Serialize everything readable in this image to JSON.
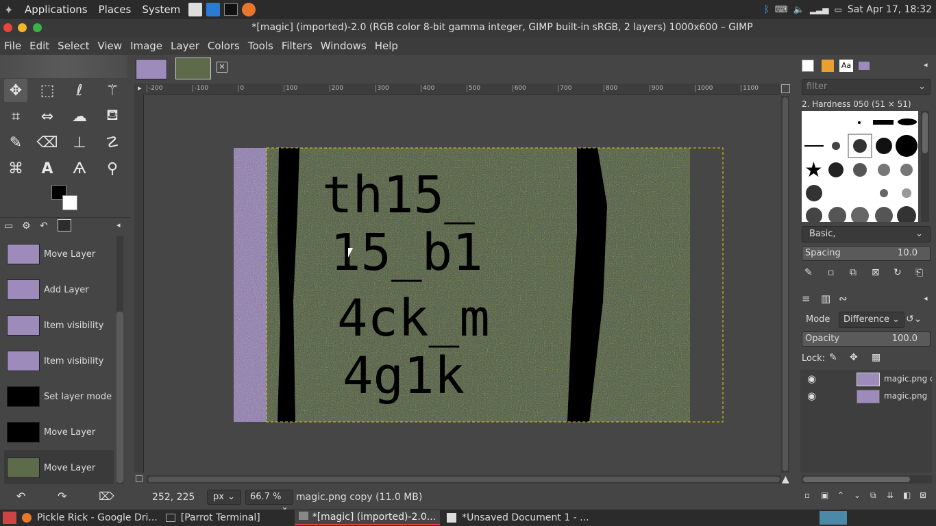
{
  "topbar": {
    "menus": [
      "Applications",
      "Places",
      "System"
    ],
    "clock": "Sat Apr 17, 18:32"
  },
  "window": {
    "title": "*[magic] (imported)-2.0 (RGB color 8-bit gamma integer, GIMP built-in sRGB, 2 layers) 1000x600 – GIMP"
  },
  "menubar": [
    "File",
    "Edit",
    "Select",
    "View",
    "Image",
    "Layer",
    "Colors",
    "Tools",
    "Filters",
    "Windows",
    "Help"
  ],
  "history": [
    {
      "label": "Move Layer",
      "thumb": "purple"
    },
    {
      "label": "Add Layer",
      "thumb": "purple"
    },
    {
      "label": "Item visibility",
      "thumb": "purple"
    },
    {
      "label": "Item visibility",
      "thumb": "purple"
    },
    {
      "label": "Set layer mode",
      "thumb": "black"
    },
    {
      "label": "Move Layer",
      "thumb": "black"
    },
    {
      "label": "Move Layer",
      "thumb": "green"
    }
  ],
  "ruler": {
    "labels": [
      "-200",
      "-100",
      "0",
      "100",
      "200",
      "300",
      "400",
      "500",
      "600",
      "700",
      "800",
      "900",
      "1000",
      "1100"
    ]
  },
  "image": {
    "lines": [
      "th15_",
      "15_b1",
      "4ck_m",
      "4g1k"
    ]
  },
  "status": {
    "coords": "252, 225",
    "unit": "px",
    "zoom": "66.7 %",
    "layer_info": "magic.png copy (11.0 MB)"
  },
  "brushes": {
    "filter_placeholder": "filter",
    "selected_name": "2. Hardness 050 (51 × 51)",
    "preset": "Basic,",
    "spacing_label": "Spacing",
    "spacing_value": "10.0"
  },
  "layers": {
    "mode_label": "Mode",
    "mode_value": "Difference",
    "opacity_label": "Opacity",
    "opacity_value": "100.0",
    "lock_label": "Lock:",
    "items": [
      {
        "name": "magic.png co"
      },
      {
        "name": "magic.png"
      }
    ]
  },
  "taskbar": {
    "items": [
      "Pickle Rick - Google Dri...",
      "[Parrot Terminal]",
      "*[magic] (imported)-2.0...",
      "*Unsaved Document 1 - ..."
    ]
  },
  "colors": {
    "accent": "#9d8cbb",
    "image_green": "#5e6b4b"
  }
}
